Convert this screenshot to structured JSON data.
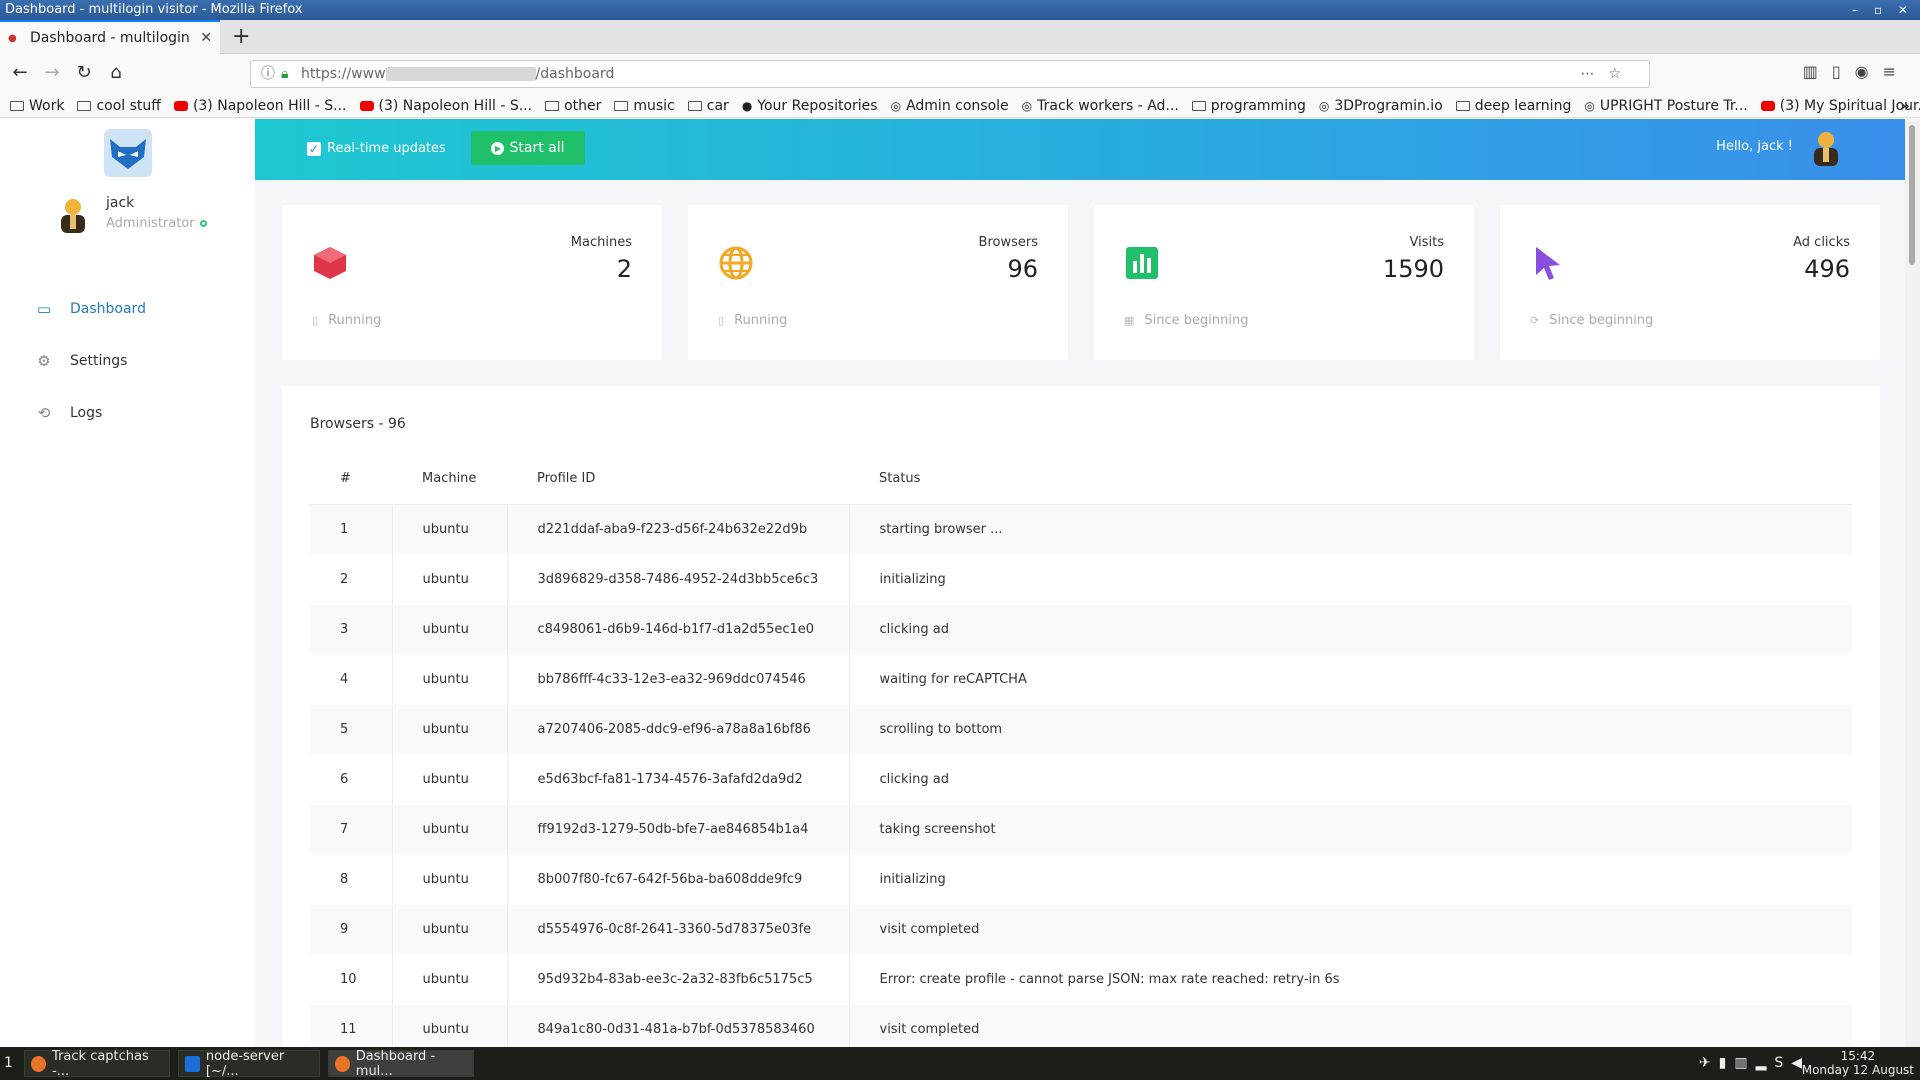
{
  "window": {
    "title": "Dashboard - multilogin visitor - Mozilla Firefox"
  },
  "browser": {
    "tab_title": "Dashboard - multilogin v",
    "url_prefix": "https://www",
    "url_suffix": "/dashboard",
    "bookmarks": [
      {
        "label": "Work",
        "icon": "folder"
      },
      {
        "label": "cool stuff",
        "icon": "folder"
      },
      {
        "label": "(3) Napoleon Hill - S...",
        "icon": "youtube"
      },
      {
        "label": "(3) Napoleon Hill - S...",
        "icon": "youtube"
      },
      {
        "label": "other",
        "icon": "folder"
      },
      {
        "label": "music",
        "icon": "folder"
      },
      {
        "label": "car",
        "icon": "folder"
      },
      {
        "label": "Your Repositories",
        "icon": "github"
      },
      {
        "label": "Admin console",
        "icon": "globe"
      },
      {
        "label": "Track workers - Ad...",
        "icon": "globe"
      },
      {
        "label": "programming",
        "icon": "folder"
      },
      {
        "label": "3DProgramin.io",
        "icon": "globe"
      },
      {
        "label": "deep learning",
        "icon": "folder"
      },
      {
        "label": "UPRIGHT Posture Tr...",
        "icon": "globe"
      },
      {
        "label": "(3) My Spiritual Jour...",
        "icon": "youtube"
      }
    ]
  },
  "sidebar": {
    "user_name": "jack",
    "user_role": "Administrator",
    "items": [
      {
        "label": "Dashboard",
        "icon": "monitor-icon"
      },
      {
        "label": "Settings",
        "icon": "gear-icon"
      },
      {
        "label": "Logs",
        "icon": "history-icon"
      }
    ]
  },
  "header": {
    "realtime_label": "Real-time updates",
    "realtime_checked": true,
    "start_label": "Start all",
    "greeting": "Hello, jack !"
  },
  "stats": [
    {
      "label": "Machines",
      "value": "2",
      "footer": "Running",
      "icon": "cube-icon",
      "color": "#e0344a"
    },
    {
      "label": "Browsers",
      "value": "96",
      "footer": "Running",
      "icon": "globe-icon",
      "color": "#f5a623"
    },
    {
      "label": "Visits",
      "value": "1590",
      "footer": "Since beginning",
      "icon": "bar-chart-icon",
      "color": "#20c06a"
    },
    {
      "label": "Ad clicks",
      "value": "496",
      "footer": "Since beginning",
      "icon": "cursor-icon",
      "color": "#8a4fe0"
    }
  ],
  "table": {
    "title": "Browsers - 96",
    "columns": [
      "#",
      "Machine",
      "Profile ID",
      "Status"
    ],
    "rows": [
      [
        "1",
        "ubuntu",
        "d221ddaf-aba9-f223-d56f-24b632e22d9b",
        "starting browser ..."
      ],
      [
        "2",
        "ubuntu",
        "3d896829-d358-7486-4952-24d3bb5ce6c3",
        "initializing"
      ],
      [
        "3",
        "ubuntu",
        "c8498061-d6b9-146d-b1f7-d1a2d55ec1e0",
        "clicking ad"
      ],
      [
        "4",
        "ubuntu",
        "bb786fff-4c33-12e3-ea32-969ddc074546",
        "waiting for reCAPTCHA"
      ],
      [
        "5",
        "ubuntu",
        "a7207406-2085-ddc9-ef96-a78a8a16bf86",
        "scrolling to bottom"
      ],
      [
        "6",
        "ubuntu",
        "e5d63bcf-fa81-1734-4576-3afafd2da9d2",
        "clicking ad"
      ],
      [
        "7",
        "ubuntu",
        "ff9192d3-1279-50db-bfe7-ae846854b1a4",
        "taking screenshot"
      ],
      [
        "8",
        "ubuntu",
        "8b007f80-fc67-642f-56ba-ba608dde9fc9",
        "initializing"
      ],
      [
        "9",
        "ubuntu",
        "d5554976-0c8f-2641-3360-5d78375e03fe",
        "visit completed"
      ],
      [
        "10",
        "ubuntu",
        "95d932b4-83ab-ee3c-2a32-83fb6c5175c5",
        "Error: create profile - cannot parse JSON: max rate reached: retry-in 6s"
      ],
      [
        "11",
        "ubuntu",
        "849a1c80-0d31-481a-b7bf-0d5378583460",
        "visit completed"
      ]
    ]
  },
  "taskbar": {
    "workspace": "1",
    "tasks": [
      "Track captchas -...",
      "node-server [~/...",
      "Dashboard - mul..."
    ],
    "time": "15:42",
    "date": "Monday 12 August"
  }
}
